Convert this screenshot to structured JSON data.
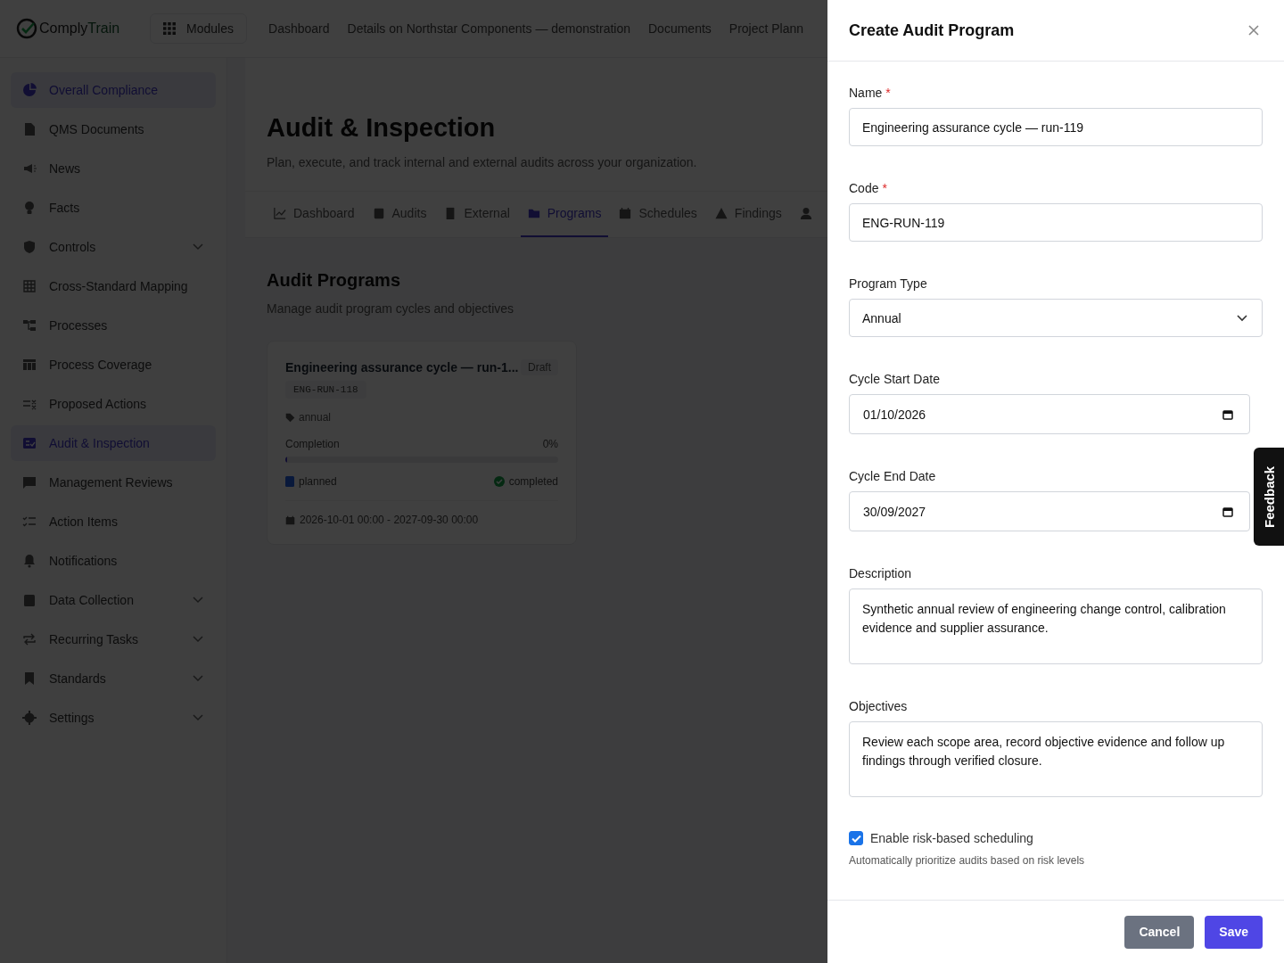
{
  "brand": {
    "name_part_1": "Comply",
    "name_part_2": "Train"
  },
  "modules_button": "Modules",
  "top_nav": [
    "Dashboard",
    "Details on Northstar Components — demonstration",
    "Documents",
    "Project Plann"
  ],
  "sidebar": {
    "items": [
      {
        "label": "Overall Compliance",
        "selected": true,
        "expandable": false
      },
      {
        "label": "QMS Documents",
        "selected": false,
        "expandable": false
      },
      {
        "label": "News",
        "selected": false,
        "expandable": false
      },
      {
        "label": "Facts",
        "selected": false,
        "expandable": false
      },
      {
        "label": "Controls",
        "selected": false,
        "expandable": true
      },
      {
        "label": "Cross-Standard Mapping",
        "selected": false,
        "expandable": false
      },
      {
        "label": "Processes",
        "selected": false,
        "expandable": false
      },
      {
        "label": "Process Coverage",
        "selected": false,
        "expandable": false
      },
      {
        "label": "Proposed Actions",
        "selected": false,
        "expandable": false
      },
      {
        "label": "Audit & Inspection",
        "selected": true,
        "expandable": false
      },
      {
        "label": "Management Reviews",
        "selected": false,
        "expandable": false
      },
      {
        "label": "Action Items",
        "selected": false,
        "expandable": false
      },
      {
        "label": "Notifications",
        "selected": false,
        "expandable": false
      },
      {
        "label": "Data Collection",
        "selected": false,
        "expandable": true
      },
      {
        "label": "Recurring Tasks",
        "selected": false,
        "expandable": true
      },
      {
        "label": "Standards",
        "selected": false,
        "expandable": true
      },
      {
        "label": "Settings",
        "selected": false,
        "expandable": true
      }
    ]
  },
  "page": {
    "title": "Audit & Inspection",
    "subtitle": "Plan, execute, and track internal and external audits across your organization."
  },
  "tabs": [
    {
      "label": "Dashboard",
      "selected": false
    },
    {
      "label": "Audits",
      "selected": false
    },
    {
      "label": "External",
      "selected": false
    },
    {
      "label": "Programs",
      "selected": true
    },
    {
      "label": "Schedules",
      "selected": false
    },
    {
      "label": "Findings",
      "selected": false
    },
    {
      "selected": false
    }
  ],
  "section": {
    "title": "Audit Programs",
    "subtitle": "Manage audit program cycles and objectives"
  },
  "program_card": {
    "title": "Engineering assurance cycle — run-1...",
    "status": "Draft",
    "code": "ENG-RUN-118",
    "type": "annual",
    "completion_label": "Completion",
    "completion_value": "0%",
    "level": 0,
    "planned": "planned",
    "completed": "completed",
    "dates": "2026-10-01 00:00 - 2027-09-30 00:00"
  },
  "drawer": {
    "title": "Create Audit Program",
    "required_marker": "*",
    "fields": [
      {
        "kind": "text",
        "label": "Name",
        "required": true,
        "value": "Engineering assurance cycle — run-119"
      },
      {
        "kind": "text",
        "label": "Code",
        "required": true,
        "value": "ENG-RUN-119"
      },
      {
        "kind": "select",
        "label": "Program Type",
        "required": false,
        "value": "Annual"
      },
      {
        "kind": "date",
        "label": "Cycle Start Date",
        "required": false,
        "value": "01/10/2026"
      },
      {
        "kind": "date",
        "label": "Cycle End Date",
        "required": false,
        "value": "30/09/2027"
      },
      {
        "kind": "textarea",
        "label": "Description",
        "required": false,
        "value": "Synthetic annual review of engineering change control, calibration evidence and supplier assurance."
      },
      {
        "kind": "textarea",
        "label": "Objectives",
        "required": false,
        "value": "Review each scope area, record objective evidence and follow up findings through verified closure."
      }
    ],
    "checkbox": {
      "label": "Enable risk-based scheduling",
      "checked": true,
      "help": "Automatically prioritize audits based on risk levels"
    },
    "buttons": [
      {
        "label": "Cancel",
        "kind": "secondary"
      },
      {
        "label": "Save",
        "kind": "primary"
      }
    ]
  },
  "feedback_tab": "Feedback"
}
